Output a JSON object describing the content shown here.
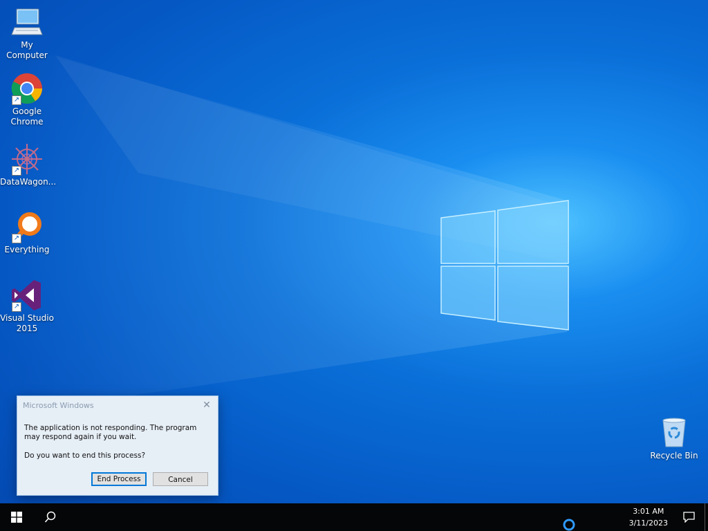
{
  "desktop": {
    "icons": [
      {
        "label": "My Computer"
      },
      {
        "label": "Google Chrome"
      },
      {
        "label": "DataWagon..."
      },
      {
        "label": "Everything"
      },
      {
        "label": "Visual Studio 2015"
      },
      {
        "label": "Recycle Bin"
      }
    ]
  },
  "dialog": {
    "title": "Microsoft Windows",
    "message": "The application is not responding. The program may respond again if you wait.",
    "question": "Do you want to end this process?",
    "end_process_label": "End Process",
    "cancel_label": "Cancel"
  },
  "taskbar": {
    "time": "3:01 AM",
    "date": "3/11/2023",
    "icons": [
      "windows-start-icon",
      "search-icon",
      "cortana-icon",
      "notifications-icon"
    ]
  },
  "colors": {
    "accent": "#0078d7",
    "taskbar": "#050607",
    "wallpaper": "#0a6fd8"
  }
}
